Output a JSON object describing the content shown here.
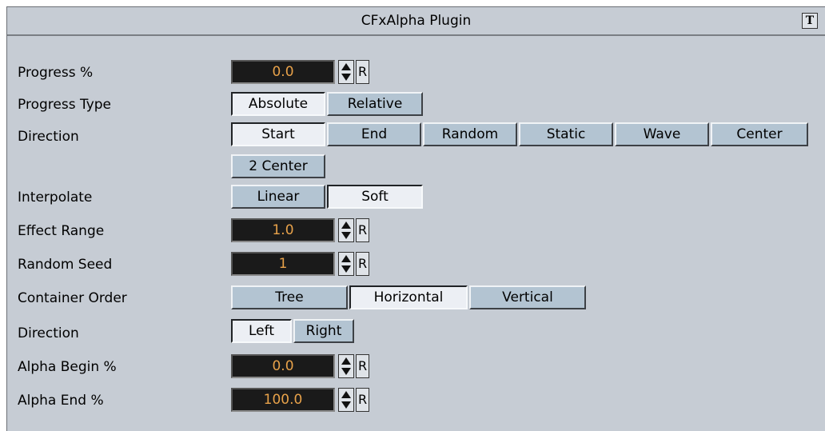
{
  "window": {
    "title": "CFxAlpha Plugin",
    "icon": "plugin-help-icon"
  },
  "colors": {
    "panel": "#c6ccd4",
    "button": "#b3c4d2",
    "button_selected": "#eceff4",
    "field_bg": "#1a1a1a",
    "field_text": "#e8a24a"
  },
  "reset_label": "R",
  "progress": {
    "label": "Progress %",
    "value": "0.0"
  },
  "progress_type": {
    "label": "Progress Type",
    "options": [
      "Absolute",
      "Relative"
    ],
    "selected": "Absolute"
  },
  "direction": {
    "label": "Direction",
    "options": [
      "Start",
      "End",
      "Random",
      "Static",
      "Wave",
      "Center",
      "2 Center"
    ],
    "selected": "Start"
  },
  "interpolate": {
    "label": "Interpolate",
    "options": [
      "Linear",
      "Soft"
    ],
    "selected": "Soft"
  },
  "effect_range": {
    "label": "Effect Range",
    "value": "1.0"
  },
  "random_seed": {
    "label": "Random Seed",
    "value": "1"
  },
  "container_order": {
    "label": "Container Order",
    "options": [
      "Tree",
      "Horizontal",
      "Vertical"
    ],
    "selected": "Horizontal"
  },
  "direction2": {
    "label": "Direction",
    "options": [
      "Left",
      "Right"
    ],
    "selected": "Left"
  },
  "alpha_begin": {
    "label": "Alpha Begin %",
    "value": "0.0"
  },
  "alpha_end": {
    "label": "Alpha End %",
    "value": "100.0"
  }
}
